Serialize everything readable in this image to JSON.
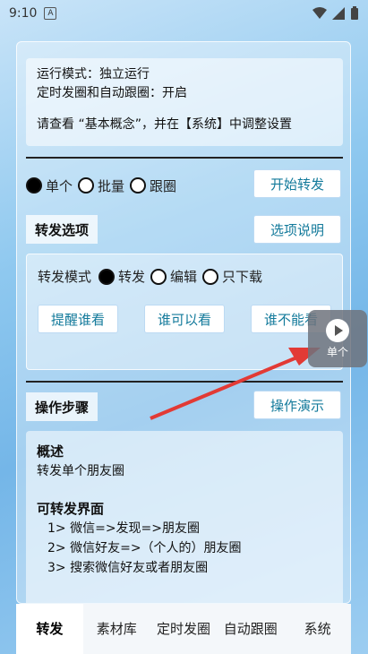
{
  "status": {
    "time": "9:10",
    "a_icon": "A"
  },
  "info": {
    "line1": "运行模式：独立运行",
    "line2": "定时发圈和自动跟圈：开启",
    "line3": "请查看 “基本概念”，并在【系统】中调整设置"
  },
  "mode_options": [
    "单个",
    "批量",
    "跟圈"
  ],
  "selected_mode": "单个",
  "start_button": "开始转发",
  "forward_options_label": "转发选项",
  "options_help_button": "选项说明",
  "forward_mode_label": "转发模式",
  "forward_modes": [
    "转发",
    "编辑",
    "只下载"
  ],
  "selected_forward_mode": "转发",
  "buttons_row": [
    "提醒谁看",
    "谁可以看",
    "谁不能看"
  ],
  "steps_label": "操作步骤",
  "demo_button": "操作演示",
  "steps": {
    "overview_title": "概述",
    "overview_text": "转发单个朋友圈",
    "screens_title": "可转发界面",
    "item1": "1> 微信=>发现=>朋友圈",
    "item2": "2> 微信好友=>（个人的）朋友圈",
    "item3": "3> 搜索微信好友或者朋友圈"
  },
  "tabs": [
    "转发",
    "素材库",
    "定时发圈",
    "自动跟圈",
    "系统"
  ],
  "active_tab": "转发",
  "float_label": "单个",
  "colors": {
    "accent": "#137a9b",
    "arrow": "#e23a35"
  }
}
